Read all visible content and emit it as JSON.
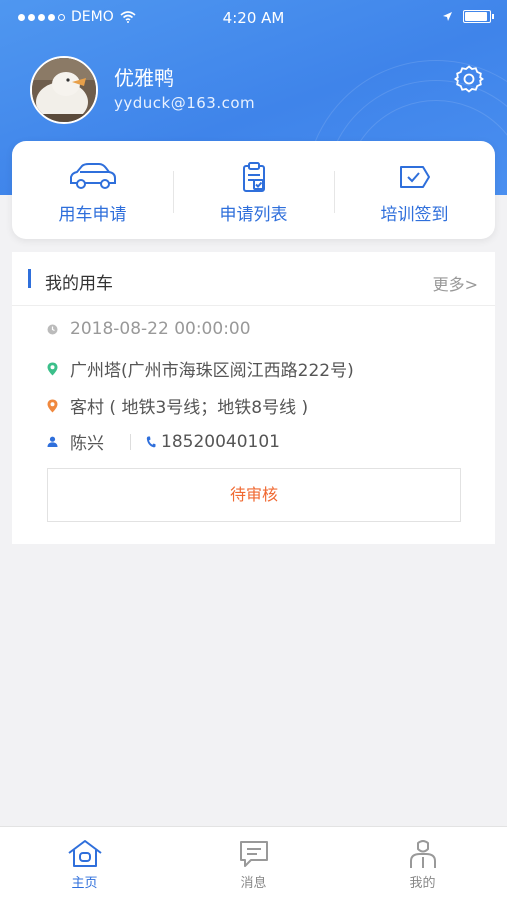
{
  "status_bar": {
    "carrier": "DEMO",
    "time": "4:20 AM"
  },
  "profile": {
    "name": "优雅鸭",
    "email": "yyduck@163.com"
  },
  "actions": [
    {
      "label": "用车申请",
      "icon": "car-icon"
    },
    {
      "label": "申请列表",
      "icon": "clipboard-icon"
    },
    {
      "label": "培训签到",
      "icon": "ticket-check-icon"
    }
  ],
  "my_car": {
    "title": "我的用车",
    "more": "更多>",
    "datetime": "2018-08-22  00:00:00",
    "origin": "广州塔(广州市海珠区阅江西路222号)",
    "destination": "客村 ( 地铁3号线；地铁8号线 )",
    "contact_name": "陈兴",
    "contact_phone": "18520040101",
    "status": "待审核"
  },
  "tabs": [
    {
      "label": "主页",
      "active": true
    },
    {
      "label": "消息",
      "active": false
    },
    {
      "label": "我的",
      "active": false
    }
  ],
  "colors": {
    "primary": "#2f6fdb",
    "header": "#4a8ff0",
    "status": "#f06a33"
  }
}
